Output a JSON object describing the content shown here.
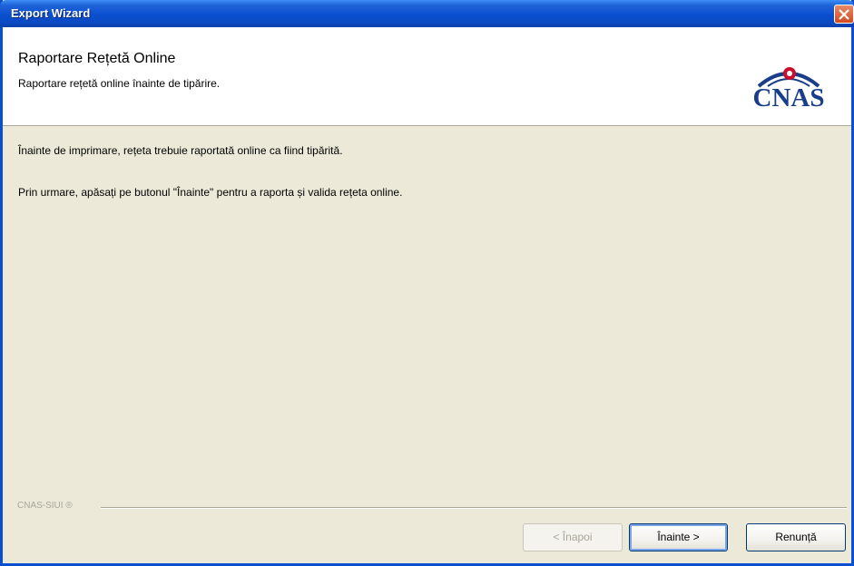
{
  "window": {
    "title": "Export Wizard"
  },
  "header": {
    "title": "Raportare Rețetă Online",
    "subtitle": "Raportare rețetă online înainte de tipărire.",
    "logo_text": "CNAS"
  },
  "content": {
    "line1": "Înainte de imprimare, rețeta trebuie raportată online ca fiind tipărită.",
    "line2": "Prin urmare, apăsați pe butonul \"Înainte\" pentru a raporta și valida rețeta online."
  },
  "footer": {
    "brand": "CNAS-SIUI ®"
  },
  "buttons": {
    "back": "< Înapoi",
    "next": "Înainte >",
    "cancel": "Renunță"
  },
  "colors": {
    "titlebar": "#0a4fcf",
    "dialog_bg": "#ece9d8",
    "logo": "#1a3d8a",
    "logo_accent": "#c8102e"
  }
}
